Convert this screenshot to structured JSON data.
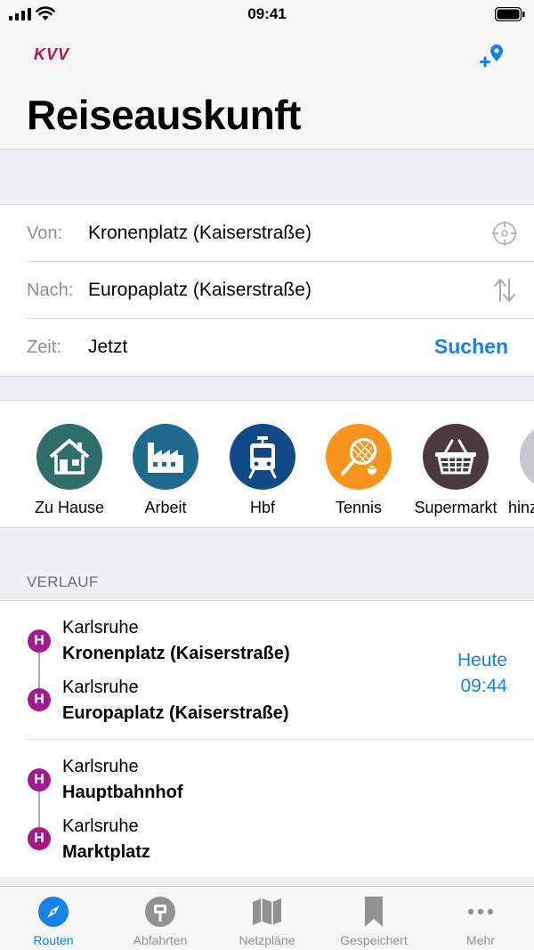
{
  "status": {
    "time": "09:41"
  },
  "header": {
    "logo": "KVV",
    "title": "Reiseauskunft"
  },
  "form": {
    "from_label": "Von:",
    "from_value": "Kronenplatz (Kaiserstraße)",
    "to_label": "Nach:",
    "to_value": "Europaplatz (Kaiserstraße)",
    "time_label": "Zeit:",
    "time_value": "Jetzt",
    "search_label": "Suchen"
  },
  "favorites": [
    {
      "label": "Zu Hause",
      "icon": "house-icon",
      "color": "#2e6e6a"
    },
    {
      "label": "Arbeit",
      "icon": "factory-icon",
      "color": "#1e6b8f"
    },
    {
      "label": "Hbf",
      "icon": "tram-icon",
      "color": "#114a87"
    },
    {
      "label": "Tennis",
      "icon": "tennis-icon",
      "color": "#f7941d"
    },
    {
      "label": "Supermarkt",
      "icon": "basket-icon",
      "color": "#4a3a40"
    },
    {
      "label": "hinzufügen",
      "icon": "add-icon",
      "color": "#c7c7cc"
    }
  ],
  "history": {
    "section_title": "VERLAUF",
    "stop_marker": "H",
    "trips": [
      {
        "from_city": "Karlsruhe",
        "from_stop": "Kronenplatz (Kaiserstraße)",
        "to_city": "Karlsruhe",
        "to_stop": "Europaplatz (Kaiserstraße)",
        "day": "Heute",
        "time": "09:44"
      },
      {
        "from_city": "Karlsruhe",
        "from_stop": "Hauptbahnhof",
        "to_city": "Karlsruhe",
        "to_stop": "Marktplatz"
      }
    ]
  },
  "tabs": [
    {
      "label": "Routen",
      "icon": "compass-icon",
      "active": true
    },
    {
      "label": "Abfahrten",
      "icon": "departure-sign-icon",
      "active": false
    },
    {
      "label": "Netzpläne",
      "icon": "map-icon",
      "active": false
    },
    {
      "label": "Gespeichert",
      "icon": "bookmark-icon",
      "active": false
    },
    {
      "label": "Mehr",
      "icon": "more-icon",
      "active": false
    }
  ],
  "colors": {
    "accent": "#1482e8",
    "brand": "#b5144a",
    "stop": "#a01c8c"
  }
}
